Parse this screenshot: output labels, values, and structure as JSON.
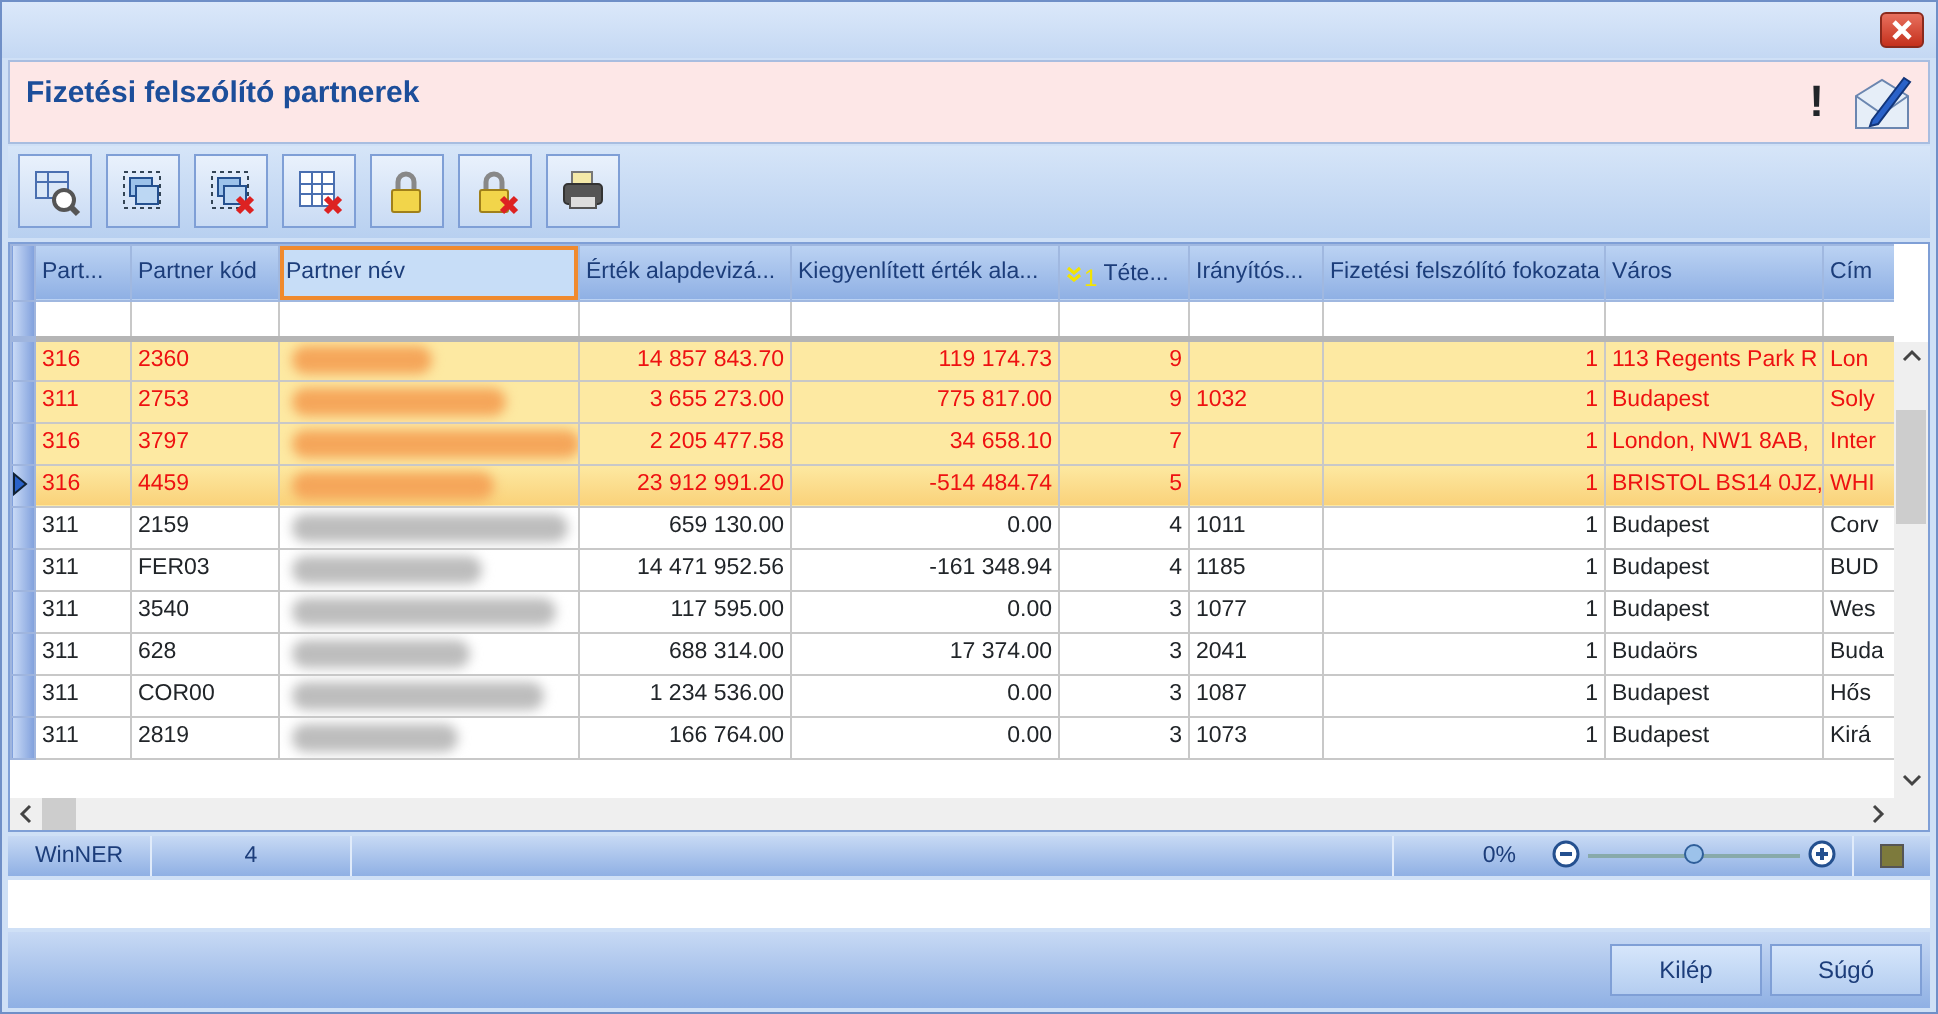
{
  "window": {
    "title": "Fizetési felszólító partnerek",
    "alert_mark": "!"
  },
  "columns": [
    {
      "label": "Part...",
      "focused": false
    },
    {
      "label": "Partner kód",
      "focused": false
    },
    {
      "label": "Partner név",
      "focused": true
    },
    {
      "label": "Érték alapdevizá...",
      "focused": false
    },
    {
      "label": "Kiegyenlített érték ala...",
      "focused": false
    },
    {
      "label": "Téte...",
      "focused": false,
      "sort_index": "1"
    },
    {
      "label": "Irányítós...",
      "focused": false
    },
    {
      "label": "Fizetési felszólító fokozata",
      "focused": false
    },
    {
      "label": "Város",
      "focused": false
    },
    {
      "label": "Cím",
      "focused": false
    }
  ],
  "rows": [
    {
      "highlighted": true,
      "selected": false,
      "part": "316",
      "code": "2360",
      "value": "14 857 843.70",
      "settled": "119 174.73",
      "items": "9",
      "level": "1",
      "city": "113 Regents Park R",
      "address": "Lon"
    },
    {
      "highlighted": true,
      "selected": false,
      "part": "311",
      "code": "2753",
      "value": "3 655 273.00",
      "settled": "775 817.00",
      "items": "9",
      "zip": "1032",
      "level": "1",
      "city": "Budapest",
      "address": "Soly"
    },
    {
      "highlighted": true,
      "selected": false,
      "part": "316",
      "code": "3797",
      "value": "2 205 477.58",
      "settled": "34 658.10",
      "items": "7",
      "level": "1",
      "city": "London, NW1 8AB,",
      "address": "Inter"
    },
    {
      "highlighted": true,
      "selected": true,
      "part": "316",
      "code": "4459",
      "value": "23 912 991.20",
      "settled": "-514 484.74",
      "items": "5",
      "level": "1",
      "city": "BRISTOL BS14 0JZ,",
      "address": "WHI"
    },
    {
      "highlighted": false,
      "selected": false,
      "part": "311",
      "code": "2159",
      "value": "659 130.00",
      "settled": "0.00",
      "items": "4",
      "zip": "1011",
      "level": "1",
      "city": "Budapest",
      "address": "Corv"
    },
    {
      "highlighted": false,
      "selected": false,
      "part": "311",
      "code": "FER03",
      "value": "14 471 952.56",
      "settled": "-161 348.94",
      "items": "4",
      "zip": "1185",
      "level": "1",
      "city": "Budapest",
      "address": "BUD"
    },
    {
      "highlighted": false,
      "selected": false,
      "part": "311",
      "code": "3540",
      "value": "117 595.00",
      "settled": "0.00",
      "items": "3",
      "zip": "1077",
      "level": "1",
      "city": "Budapest",
      "address": "Wes"
    },
    {
      "highlighted": false,
      "selected": false,
      "part": "311",
      "code": "628",
      "value": "688 314.00",
      "settled": "17 374.00",
      "items": "3",
      "zip": "2041",
      "level": "1",
      "city": "Budaörs",
      "address": "Buda"
    },
    {
      "highlighted": false,
      "selected": false,
      "part": "311",
      "code": "COR00",
      "value": "1 234 536.00",
      "settled": "0.00",
      "items": "3",
      "zip": "1087",
      "level": "1",
      "city": "Budapest",
      "address": "Hős"
    },
    {
      "highlighted": false,
      "selected": false,
      "part": "311",
      "code": "2819",
      "value": "166 764.00",
      "settled": "0.00",
      "items": "3",
      "zip": "1073",
      "level": "1",
      "city": "Budapest",
      "address": "Kirá"
    }
  ],
  "status_bar": {
    "app": "WinNER",
    "count": "4",
    "zoom_reading": "0%",
    "zoom": {
      "level": 0.5
    }
  },
  "buttons": [
    {
      "label": "Kilép"
    },
    {
      "label": "Súgó"
    }
  ]
}
